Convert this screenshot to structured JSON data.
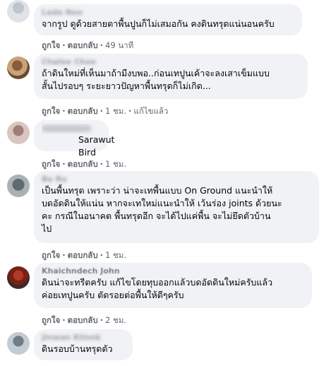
{
  "actions": {
    "like": "ถูกใจ",
    "reply": "ตอบกลับ",
    "dot": "·",
    "edited": "แก้ไขแล้ว"
  },
  "comments": [
    {
      "author": "Lada Noo",
      "text": "จากรูป ดูด้วยสายตาพื้นปูนก็ไม่เสมอกัน คงดินทรุดแน่นอนครับ",
      "time": "49 นาที"
    },
    {
      "author": "Chalee Choo",
      "text": "ถ้าดินใหม่ที่เห็นมาถ้ามีงบพอ..ก่อนเทปูนเค้าจะลงเสาเข็มแบบ\nสั้นไปรอบๆ ระยะยาวปัญหาพื้นทรุดก็ไม่เกิด...",
      "time": "1 ชม."
    },
    {
      "author": "",
      "text": "Sarawut Bird",
      "time": "1 ชม."
    },
    {
      "author": "Bo Ro",
      "text": "เป็นพื้นทรุด เพราะว่า น่าจะเทพื้นแบบ On Ground แนะนำให้\nบดอัดดินให้แน่น หากจะเทใหม่แนะนำให้ เว้นร่อง joints ด้วยนะ\nคะ กรณีในอนาคต พื้นทรุดอีก จะได้ไปแค่พื้น จะไม่ยึดตัวบ้าน\nไป",
      "time": "1 ชม."
    },
    {
      "author": "Khaichndech John",
      "text": "ดินน่าจะทรีตครับ แก้ไขโดยทุบออกแล้วบดอัดดินใหม่ครับแล้ว\nค่อยเทปูนครับ ตัดรอยต่อพื้นให้ดีๆครับ",
      "time": "2 ชม."
    },
    {
      "author": "Jinwan Klinnk",
      "text": "ดินรอบบ้านทรุดตัว",
      "time": ""
    }
  ]
}
